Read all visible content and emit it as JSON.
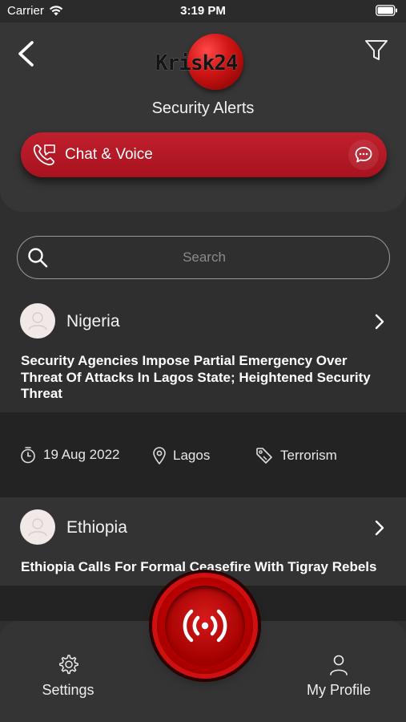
{
  "status_bar": {
    "carrier": "Carrier",
    "time": "3:19 PM"
  },
  "header": {
    "logo_text": "Krisk24",
    "title": "Security Alerts",
    "chat_voice_label": "Chat & Voice"
  },
  "search": {
    "placeholder": "Search",
    "value": ""
  },
  "alerts": [
    {
      "country": "Nigeria",
      "headline": "Security Agencies Impose Partial Emergency Over Threat Of Attacks In Lagos State; Heightened Security Threat",
      "date": "19 Aug 2022",
      "location": "Lagos",
      "category": "Terrorism"
    },
    {
      "country": "Ethiopia",
      "headline": "Ethiopia Calls For Formal Ceasefire With Tigray Rebels"
    }
  ],
  "bottom_nav": {
    "settings_label": "Settings",
    "profile_label": "My Profile"
  },
  "colors": {
    "accent": "#b51824",
    "background": "#2f2f2f",
    "card_meta": "#232323"
  }
}
